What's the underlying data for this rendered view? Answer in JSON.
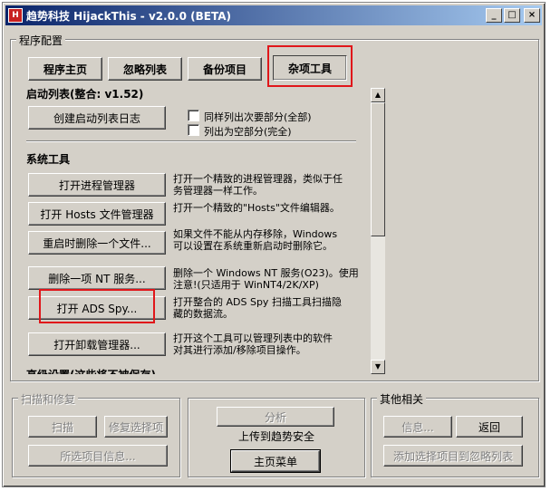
{
  "window": {
    "title": "趋势科技 HijackThis - v2.0.0 (BETA)",
    "icon_text": "H",
    "controls": [
      "_",
      "□",
      "×"
    ]
  },
  "config": {
    "group_label": "程序配置",
    "tabs": [
      "程序主页",
      "忽略列表",
      "备份项目",
      "杂项工具"
    ]
  },
  "startup": {
    "title": "启动列表(整合: v1.52)",
    "create_log_button": "创建启动列表日志",
    "checkbox1": "同样列出次要部分(全部)",
    "checkbox2": "列出为空部分(完全)"
  },
  "system_tools": {
    "title": "系统工具",
    "tools": [
      {
        "button": "打开进程管理器",
        "desc": [
          "打开一个精致的进程管理器，类似于任",
          "务管理器一样工作。"
        ]
      },
      {
        "button": "打开 Hosts 文件管理器",
        "desc": [
          "打开一个精致的\"Hosts\"文件编辑器。"
        ]
      },
      {
        "button": "重启时删除一个文件...",
        "desc": [
          "如果文件不能从内存移除，Windows",
          "可以设置在系统重新启动时删除它。"
        ]
      },
      {
        "button": "删除一项 NT 服务...",
        "desc": [
          "删除一个 Windows NT 服务(O23)。使用",
          "注意!(只适用于 WinNT4/2K/XP)"
        ]
      },
      {
        "button": "打开 ADS Spy...",
        "desc": [
          "打开整合的 ADS Spy 扫描工具扫描隐",
          "藏的数据流。"
        ]
      },
      {
        "button": "打开卸载管理器...",
        "desc": [
          "打开这个工具可以管理列表中的软件",
          "对其进行添加/移除项目操作。"
        ]
      }
    ],
    "cut_off_title": "高级设置(这些将不被保存)"
  },
  "scan_fix": {
    "group_label": "扫描和修复",
    "scan_button": "扫描",
    "fix_button": "修复选择项",
    "info_button": "所选项目信息..."
  },
  "middle": {
    "analyze_button": "分析",
    "upload_label": "上传到趋势安全",
    "main_menu_button": "主页菜单"
  },
  "other": {
    "group_label": "其他相关",
    "info_button": "信息...",
    "back_button": "返回",
    "add_ignore_button": "添加选择项目到忽略列表"
  },
  "colors": {
    "highlight": "#e0161a",
    "titlebar_start": "#0a246a",
    "titlebar_end": "#a6caf0",
    "face": "#d4d0c8"
  }
}
